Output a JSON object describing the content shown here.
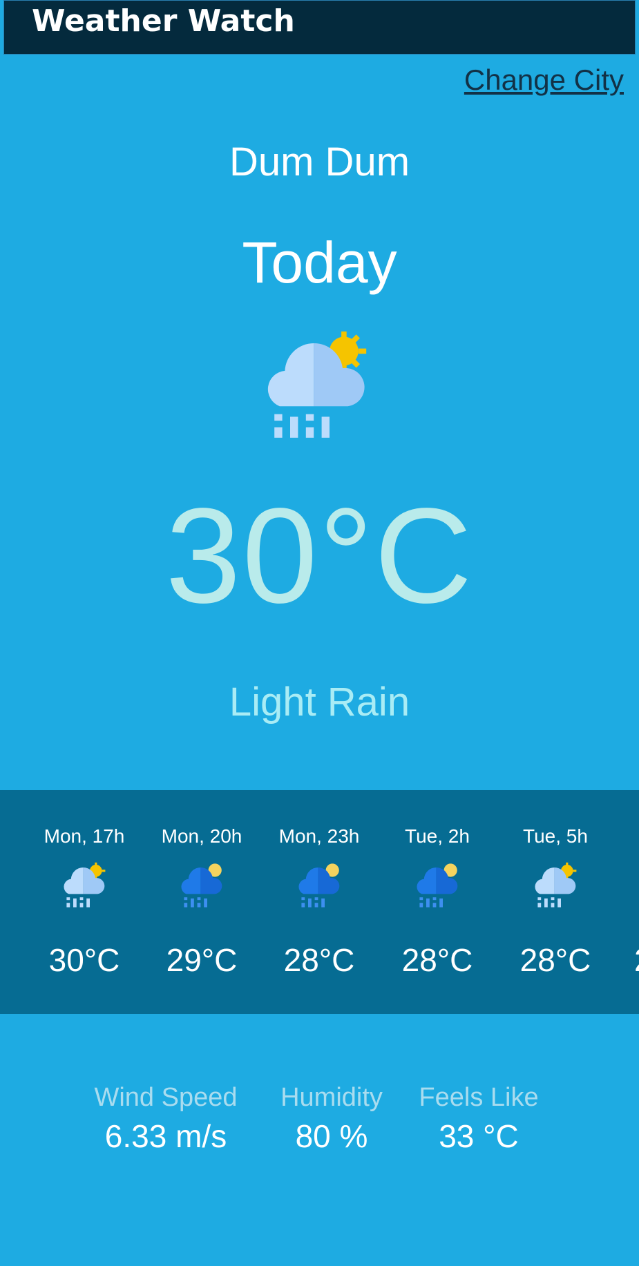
{
  "app": {
    "title": "Weather Watch",
    "change_city_label": "Change City"
  },
  "current": {
    "city": "Dum Dum",
    "day_label": "Today",
    "icon": "cloud-rain-sun-icon",
    "temperature": "30°C",
    "condition": "Light Rain"
  },
  "forecast": [
    {
      "time": "Mon, 17h",
      "temp": "30°C",
      "icon": "cloud-rain-sun-icon"
    },
    {
      "time": "Mon, 20h",
      "temp": "29°C",
      "icon": "cloud-rain-moon-icon"
    },
    {
      "time": "Mon, 23h",
      "temp": "28°C",
      "icon": "cloud-rain-moon-icon"
    },
    {
      "time": "Tue, 2h",
      "temp": "28°C",
      "icon": "cloud-rain-moon-icon"
    },
    {
      "time": "Tue, 5h",
      "temp": "28°C",
      "icon": "cloud-rain-sun-icon"
    }
  ],
  "forecast_partial_text": "2",
  "stats": {
    "wind_speed": {
      "label": "Wind Speed",
      "value": "6.33 m/s"
    },
    "humidity": {
      "label": "Humidity",
      "value": "80 %"
    },
    "feels_like": {
      "label": "Feels Like",
      "value": "33 °C"
    }
  },
  "colors": {
    "background": "#1eabe2",
    "header": "#042a3d",
    "forecast_strip": "#066c93",
    "temperature": "#b9ebeb",
    "sun": "#f5c400",
    "cloud_light": "#bcdcfc",
    "cloud_dark_blue": "#1f7ae8"
  }
}
